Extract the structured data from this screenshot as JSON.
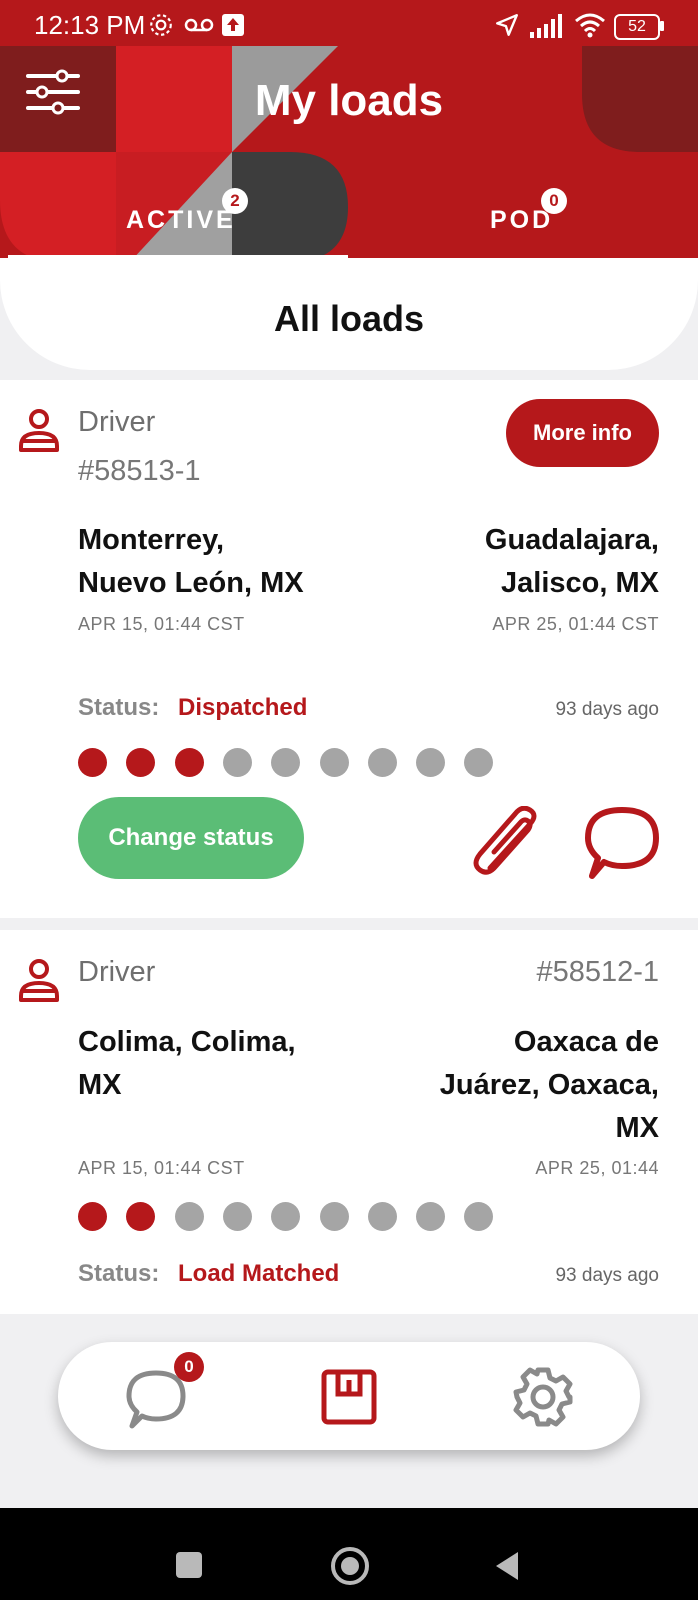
{
  "status_bar": {
    "time": "12:13 PM",
    "battery": "52"
  },
  "header": {
    "title": "My loads",
    "tabs": [
      {
        "label": "ACTIVE",
        "count": "2"
      },
      {
        "label": "POD",
        "count": "0"
      }
    ],
    "filter_icon": "sliders-icon"
  },
  "section_title": "All loads",
  "loads": [
    {
      "driver_label": "Driver",
      "load_id": "#58513-1",
      "more_info": "More info",
      "origin_line1": "Monterrey,",
      "origin_line2": "Nuevo León, MX",
      "origin_date": "APR 15, 01:44 CST",
      "dest_line1": "Guadalajara,",
      "dest_line2": "Jalisco, MX",
      "dest_date": "APR 25, 01:44 CST",
      "status_label": "Status:",
      "status_value": "Dispatched",
      "age": "93 days ago",
      "progress_steps": 9,
      "progress_done": 3,
      "change_status": "Change status"
    },
    {
      "driver_label": "Driver",
      "load_id": "#58512-1",
      "origin_line1": "Colima, Colima,",
      "origin_line2": "MX",
      "origin_date": "APR 15, 01:44 CST",
      "dest_line1": "Oaxaca de",
      "dest_line2": "Juárez, Oaxaca,",
      "dest_line3": "MX",
      "dest_date": "APR 25, 01:44",
      "status_label": "Status:",
      "status_value": "Load Matched",
      "age": "93 days ago",
      "progress_steps": 9,
      "progress_done": 2
    }
  ],
  "bottom_nav": {
    "chat_count": "0",
    "items": [
      "chat-icon",
      "loads-icon",
      "settings-icon"
    ]
  },
  "colors": {
    "brand_red": "#b5181b",
    "green": "#5bbd76",
    "inactive_dot": "#a5a5a5"
  }
}
